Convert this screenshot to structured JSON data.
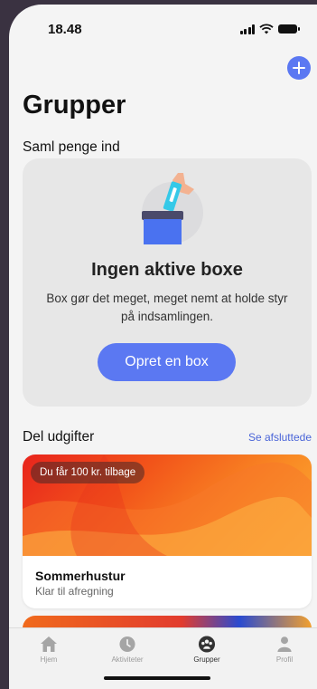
{
  "status_bar": {
    "time": "18.48"
  },
  "header": {
    "title": "Grupper",
    "add_icon": "plus-icon"
  },
  "collect": {
    "section_label": "Saml penge ind",
    "empty_title": "Ingen aktive boxe",
    "empty_description": "Box gør det meget, meget nemt at holde styr på indsamlingen.",
    "create_button": "Opret en box"
  },
  "split": {
    "section_label": "Del udgifter",
    "see_closed_link": "Se afsluttede",
    "groups": [
      {
        "badge": "Du får 100 kr. tilbage",
        "name": "Sommerhustur",
        "status": "Klar til afregning"
      }
    ]
  },
  "tabbar": {
    "items": [
      {
        "label": "Hjem",
        "icon": "home-icon"
      },
      {
        "label": "Aktiviteter",
        "icon": "clock-icon"
      },
      {
        "label": "Grupper",
        "icon": "groups-icon",
        "active": true
      },
      {
        "label": "Profil",
        "icon": "person-icon"
      }
    ]
  },
  "colors": {
    "accent": "#5b78f2",
    "link": "#4a65d8",
    "background": "#f4f4f4"
  }
}
